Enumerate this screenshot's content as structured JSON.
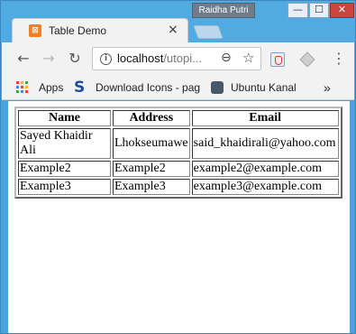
{
  "window": {
    "profile_name": "Raidha Putri",
    "min_glyph": "—",
    "max_glyph": "☐",
    "close_glyph": "✕"
  },
  "tab": {
    "title": "Table Demo",
    "favicon_text": "⊠",
    "close_glyph": "×"
  },
  "toolbar": {
    "back_glyph": "←",
    "forward_glyph": "→",
    "reload_glyph": "↻",
    "info_glyph": "i",
    "url_host": "localhost",
    "url_path": "/utopi...",
    "zoom_glyph": "⊖",
    "star_glyph": "☆",
    "menu_glyph": "⋮"
  },
  "bookmarks": {
    "apps_label": "Apps",
    "download_icon_glyph": "S",
    "download_label": "Download Icons - pag",
    "ubuntu_label": "Ubuntu Kanal",
    "more_glyph": "»"
  },
  "table": {
    "headers": [
      "Name",
      "Address",
      "Email"
    ],
    "rows": [
      [
        "Sayed Khaidir Ali",
        "Lhokseumawe",
        "said_khaidirali@yahoo.com"
      ],
      [
        "Example2",
        "Example2",
        "example2@example.com"
      ],
      [
        "Example3",
        "Example3",
        "example3@example.com"
      ]
    ]
  },
  "colors": {
    "titlebar": "#52aae3",
    "favicon": "#f27f24",
    "close_button": "#c9463d"
  }
}
